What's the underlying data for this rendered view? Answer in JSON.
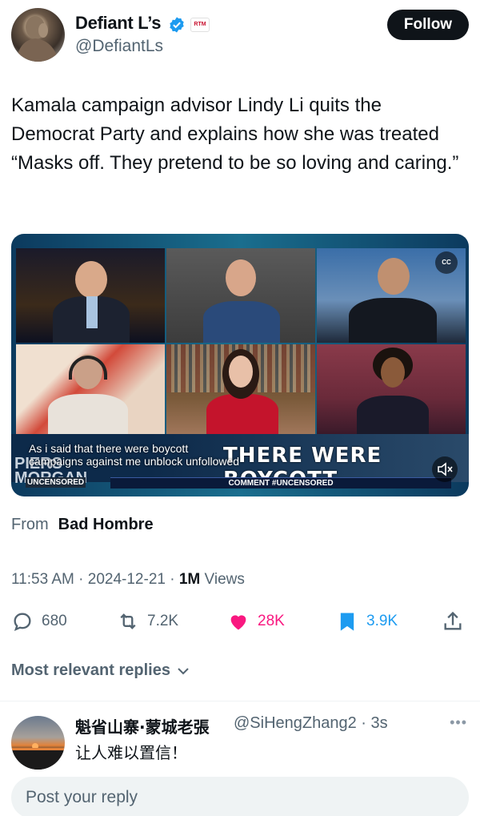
{
  "author": {
    "display_name": "Defiant L’s",
    "handle": "@DefiantLs",
    "affiliate_badge": "RTM",
    "verified": true
  },
  "follow_label": "Follow",
  "tweet": {
    "text": "Kamala campaign advisor Lindy Li quits the Democrat Party and explains how she was treated “Masks off. They pretend to be so loving and caring.”"
  },
  "media": {
    "caption_line1": "As i said that there were boycott",
    "caption_line2": "campaigns against me unblock unfollowed",
    "lower_third": "THERE WERE BOYCOTT",
    "show_name_line1": "PIERS",
    "show_name_line2": "MORGAN",
    "uncensored_tag": "UNCENSORED",
    "ticker": "COMMENT #UNCENSORED",
    "cc_label": "CC"
  },
  "source": {
    "from_label": "From",
    "from_name": "Bad Hombre"
  },
  "meta": {
    "time": "11:53 AM",
    "date": "2024-12-21",
    "views_count": "1M",
    "views_label": "Views"
  },
  "actions": {
    "replies": "680",
    "reposts": "7.2K",
    "likes": "28K",
    "bookmarks": "3.9K"
  },
  "colors": {
    "like": "#f91880",
    "bookmark": "#1d9bf0",
    "secondary": "#536471"
  },
  "replies_filter": "Most relevant replies",
  "reply": {
    "name": "魁省山寨·蒙城老張",
    "handle": "@SiHengZhang2",
    "time": "3s",
    "text": "让人难以置信！"
  },
  "composer": {
    "placeholder": "Post your reply"
  }
}
